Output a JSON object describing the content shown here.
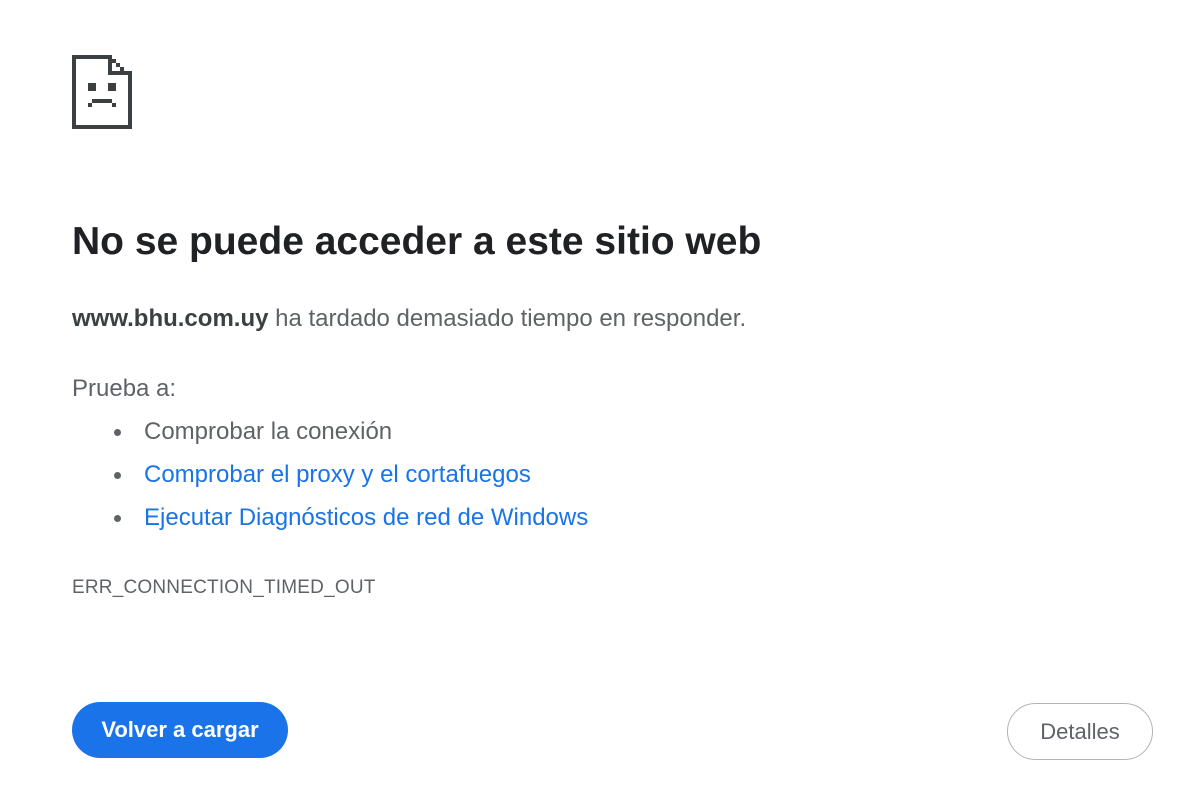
{
  "error_page": {
    "icon": "sad-page-icon",
    "title": "No se puede acceder a este sitio web",
    "host": "www.bhu.com.uy",
    "summary_rest": " ha tardado demasiado tiempo en responder.",
    "try_label": "Prueba a:",
    "suggestions": [
      {
        "label": "Comprobar la conexión",
        "is_link": false
      },
      {
        "label": "Comprobar el proxy y el cortafuegos",
        "is_link": true
      },
      {
        "label": "Ejecutar Diagnósticos de red de Windows",
        "is_link": true
      }
    ],
    "error_code": "ERR_CONNECTION_TIMED_OUT",
    "reload_label": "Volver a cargar",
    "details_label": "Detalles"
  },
  "colors": {
    "primary": "#1a73e8",
    "title_text": "#202124",
    "body_text": "#5f6368"
  }
}
